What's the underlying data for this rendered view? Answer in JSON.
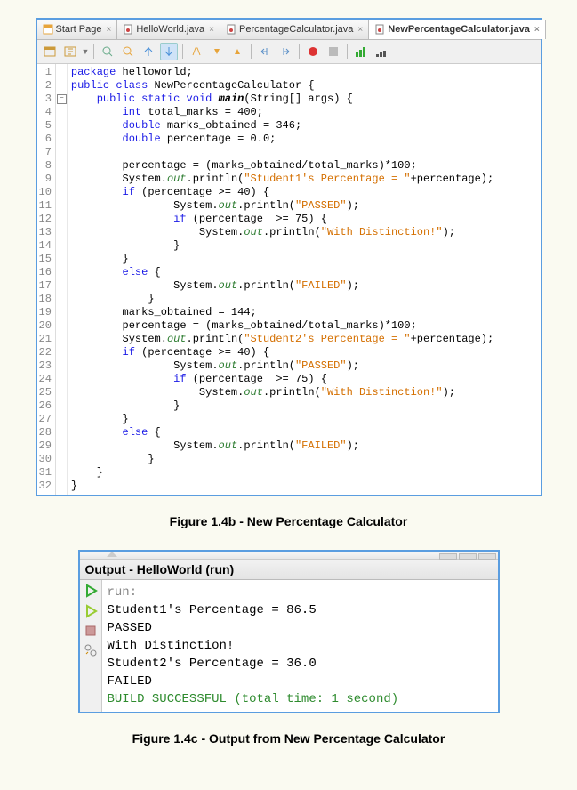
{
  "tabs": [
    {
      "label": "Start Page"
    },
    {
      "label": "HelloWorld.java"
    },
    {
      "label": "PercentageCalculator.java"
    },
    {
      "label": "NewPercentageCalculator.java"
    }
  ],
  "active_tab_index": 3,
  "code_lines": [
    {
      "n": 1,
      "html": "<span class='kw'>package</span> helloworld;"
    },
    {
      "n": 2,
      "html": "<span class='kw'>public class</span> NewPercentageCalculator {"
    },
    {
      "n": 3,
      "html": "    <span class='kw'>public static</span> <span class='kw'>void</span> <span class='bold ital'>main</span>(String[] args) {",
      "fold": true
    },
    {
      "n": 4,
      "html": "        <span class='kw'>int</span> total_marks = 400;"
    },
    {
      "n": 5,
      "html": "        <span class='kw'>double</span> marks_obtained = 346;"
    },
    {
      "n": 6,
      "html": "        <span class='kw'>double</span> percentage = 0.0;"
    },
    {
      "n": 7,
      "html": ""
    },
    {
      "n": 8,
      "html": "        percentage = (marks_obtained/total_marks)*100;"
    },
    {
      "n": 9,
      "html": "        System.<span class='fld ital'>out</span>.println(<span class='str'>\"Student1's Percentage = \"</span>+percentage);"
    },
    {
      "n": 10,
      "html": "        <span class='kw'>if</span> (percentage &gt;= 40) {"
    },
    {
      "n": 11,
      "html": "                System.<span class='fld ital'>out</span>.println(<span class='str'>\"PASSED\"</span>);"
    },
    {
      "n": 12,
      "html": "                <span class='kw'>if</span> (percentage  &gt;= 75) {"
    },
    {
      "n": 13,
      "html": "                    System.<span class='fld ital'>out</span>.println(<span class='str'>\"With Distinction!\"</span>);"
    },
    {
      "n": 14,
      "html": "                }"
    },
    {
      "n": 15,
      "html": "        }"
    },
    {
      "n": 16,
      "html": "        <span class='kw'>else</span> {"
    },
    {
      "n": 17,
      "html": "                System.<span class='fld ital'>out</span>.println(<span class='str'>\"FAILED\"</span>);"
    },
    {
      "n": 18,
      "html": "            }"
    },
    {
      "n": 19,
      "html": "        marks_obtained = 144;"
    },
    {
      "n": 20,
      "html": "        percentage = (marks_obtained/total_marks)*100;"
    },
    {
      "n": 21,
      "html": "        System.<span class='fld ital'>out</span>.println(<span class='str'>\"Student2's Percentage = \"</span>+percentage);"
    },
    {
      "n": 22,
      "html": "        <span class='kw'>if</span> (percentage &gt;= 40) {"
    },
    {
      "n": 23,
      "html": "                System.<span class='fld ital'>out</span>.println(<span class='str'>\"PASSED\"</span>);"
    },
    {
      "n": 24,
      "html": "                <span class='kw'>if</span> (percentage  &gt;= 75) {"
    },
    {
      "n": 25,
      "html": "                    System.<span class='fld ital'>out</span>.println(<span class='str'>\"With Distinction!\"</span>);"
    },
    {
      "n": 26,
      "html": "                }"
    },
    {
      "n": 27,
      "html": "        }"
    },
    {
      "n": 28,
      "html": "        <span class='kw'>else</span> {"
    },
    {
      "n": 29,
      "html": "                System.<span class='fld ital'>out</span>.println(<span class='str'>\"FAILED\"</span>);"
    },
    {
      "n": 30,
      "html": "            }"
    },
    {
      "n": 31,
      "html": "    }"
    },
    {
      "n": 32,
      "html": "}"
    }
  ],
  "caption1": "Figure 1.4b - New Percentage Calculator",
  "output_title": "Output - HelloWorld (run)",
  "output_lines": [
    {
      "text": "run:",
      "cls": "run-gray"
    },
    {
      "text": "Student1's Percentage = 86.5",
      "cls": ""
    },
    {
      "text": "PASSED",
      "cls": ""
    },
    {
      "text": "With Distinction!",
      "cls": ""
    },
    {
      "text": "Student2's Percentage = 36.0",
      "cls": ""
    },
    {
      "text": "FAILED",
      "cls": ""
    },
    {
      "text": "BUILD SUCCESSFUL (total time: 1 second)",
      "cls": "build-green"
    }
  ],
  "caption2": "Figure 1.4c - Output from New Percentage Calculator"
}
